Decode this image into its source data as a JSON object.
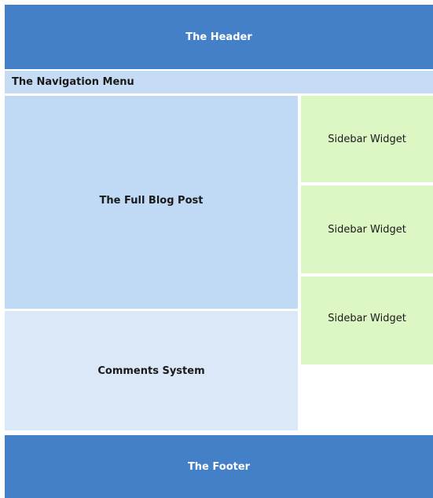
{
  "header": {
    "label": "The Header"
  },
  "nav": {
    "label": "The Navigation Menu"
  },
  "post": {
    "label": "The Full Blog Post"
  },
  "comments": {
    "label": "Comments System"
  },
  "sidebar": {
    "widgets": [
      {
        "label": "Sidebar Widget"
      },
      {
        "label": "Sidebar Widget"
      },
      {
        "label": "Sidebar Widget"
      }
    ]
  },
  "footer": {
    "label": "The Footer"
  },
  "colors": {
    "header_footer": "#4480c8",
    "nav": "#c5dcf4",
    "post": "#c0d9f4",
    "comments": "#dae8f7",
    "widget": "#dcf7c4"
  }
}
